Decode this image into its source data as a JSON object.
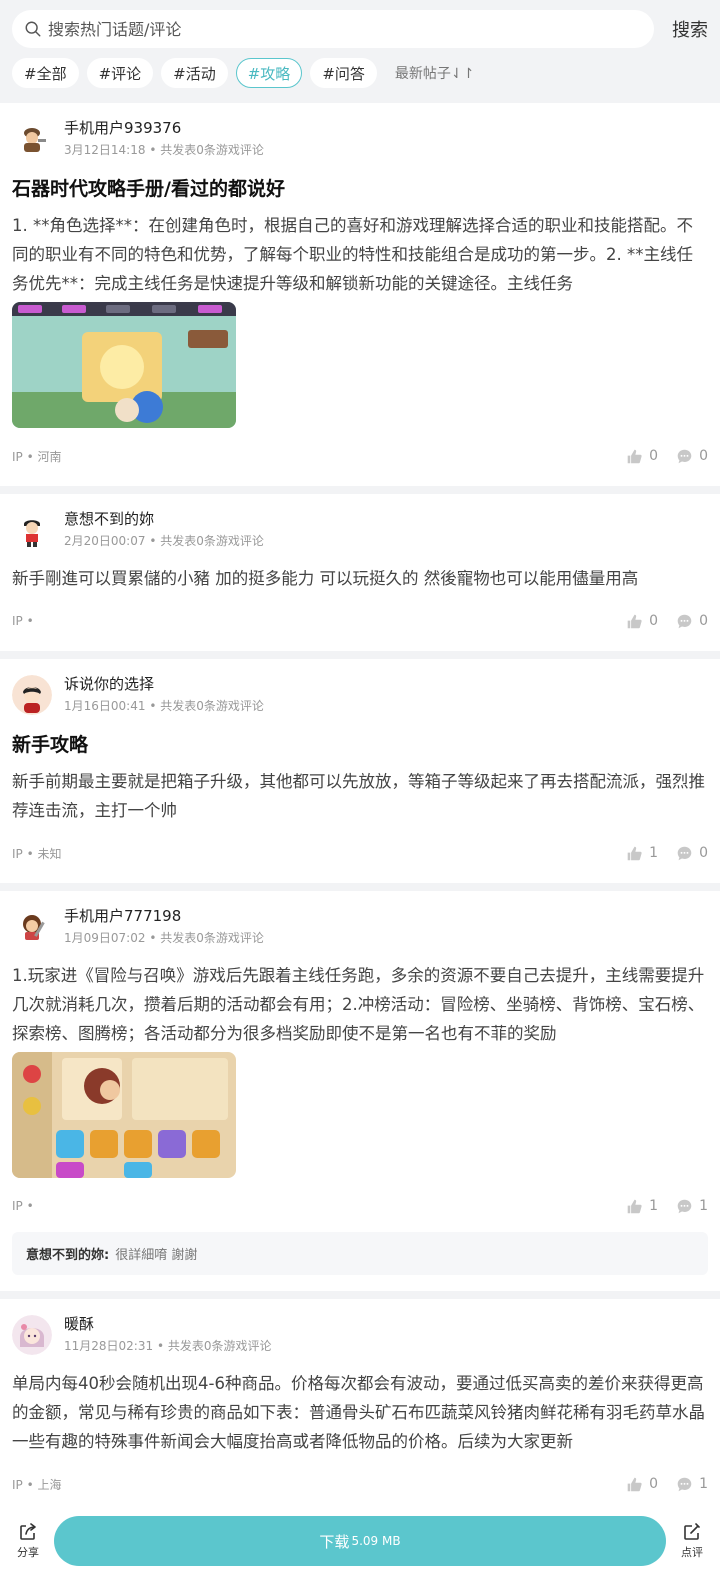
{
  "search": {
    "placeholder": "搜索热门话题/评论",
    "button": "搜索"
  },
  "tags": [
    {
      "label": "#全部"
    },
    {
      "label": "#评论"
    },
    {
      "label": "#活动"
    },
    {
      "label": "#攻略",
      "active": true
    },
    {
      "label": "#问答"
    }
  ],
  "sort_label": "最新帖子⇃↾",
  "posts": [
    {
      "author": "手机用户939376",
      "date": "3月12日14:18",
      "sub": "• 共发表0条游戏评论",
      "title": "石器时代攻略手册/看过的都说好",
      "body": "1. **角色选择**：在创建角色时，根据自己的喜好和游戏理解选择合适的职业和技能搭配。不同的职业有不同的特色和优势，了解每个职业的特性和技能组合是成功的第一步。2. **主线任务优先**：完成主线任务是快速提升等级和解锁新功能的关键途径。主线任务",
      "ip": "IP • 河南",
      "likes": "0",
      "comments": "0"
    },
    {
      "author": "意想不到的妳",
      "date": "2月20日00:07",
      "sub": "• 共发表0条游戏评论",
      "body": "新手剛進可以買累儲的小豬 加的挺多能力 可以玩挺久的 然後寵物也可以能用儘量用高",
      "ip": "IP •",
      "likes": "0",
      "comments": "0"
    },
    {
      "author": "诉说你的选择",
      "date": "1月16日00:41",
      "sub": "• 共发表0条游戏评论",
      "title": "新手攻略",
      "body": "新手前期最主要就是把箱子升级，其他都可以先放放，等箱子等级起来了再去搭配流派，强烈推荐连击流，主打一个帅",
      "ip": "IP • 未知",
      "likes": "1",
      "comments": "0"
    },
    {
      "author": "手机用户777198",
      "date": "1月09日07:02",
      "sub": "• 共发表0条游戏评论",
      "body": "1.玩家进《冒险与召唤》游戏后先跟着主线任务跑，多余的资源不要自己去提升，主线需要提升几次就消耗几次，攒着后期的活动都会有用；2.冲榜活动：冒险榜、坐骑榜、背饰榜、宝石榜、探索榜、图腾榜；各活动都分为很多档奖励即使不是第一名也有不菲的奖励",
      "ip": "IP •",
      "likes": "1",
      "comments": "1",
      "reply_author": "意想不到的妳:",
      "reply_text": "很詳細唷 謝謝"
    },
    {
      "author": "暖酥",
      "date": "11月28日02:31",
      "sub": "• 共发表0条游戏评论",
      "body": "单局内每40秒会随机出现4-6种商品。价格每次都会有波动，要通过低买高卖的差价来获得更高的金额，常见与稀有珍贵的商品如下表：普通骨头矿石布匹蔬菜风铃猪肉鲜花稀有羽毛药草水晶一些有趣的特殊事件新闻会大幅度抬高或者降低物品的价格。后续为大家更新",
      "ip": "IP • 上海",
      "likes": "0",
      "comments": "1"
    }
  ],
  "bottom": {
    "share": "分享",
    "download": "下载",
    "size": "5.09 MB",
    "review": "点评"
  },
  "colors": {
    "accent": "#5bc6cd"
  }
}
